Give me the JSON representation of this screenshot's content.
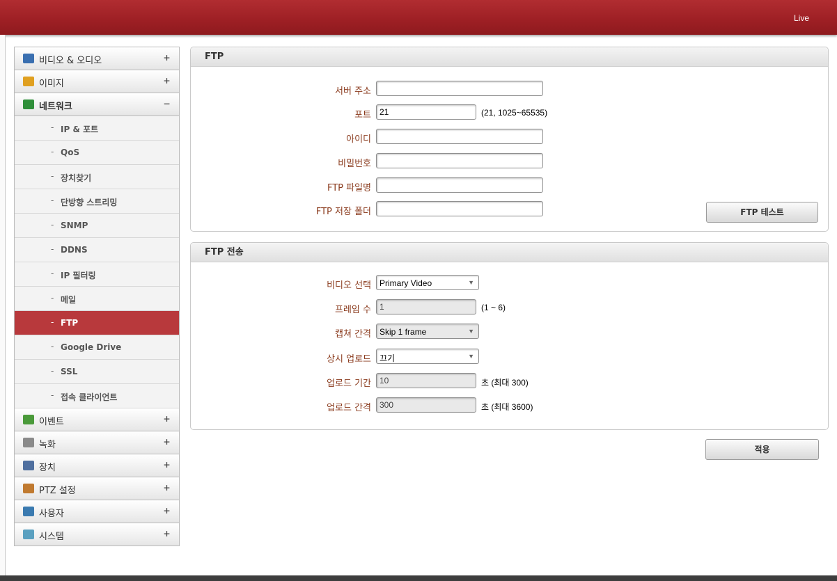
{
  "header": {
    "live_label": "Live"
  },
  "sidebar": {
    "menus_top": [
      {
        "label": "비디오 & 오디오",
        "toggle": "+",
        "icon": "video-audio-icon",
        "color": "#3a6fb0"
      },
      {
        "label": "이미지",
        "toggle": "+",
        "icon": "image-icon",
        "color": "#e0a020"
      },
      {
        "label": "네트워크",
        "toggle": "−",
        "icon": "network-icon",
        "color": "#2f8f3a"
      }
    ],
    "sub_items": [
      {
        "label": "IP & 포트"
      },
      {
        "label": "QoS"
      },
      {
        "label": "장치찾기"
      },
      {
        "label": "단방향 스트리밍"
      },
      {
        "label": "SNMP"
      },
      {
        "label": "DDNS"
      },
      {
        "label": "IP 필터링"
      },
      {
        "label": "메일"
      },
      {
        "label": "FTP"
      },
      {
        "label": "Google Drive"
      },
      {
        "label": "SSL"
      },
      {
        "label": "접속 클라이언트"
      }
    ],
    "sub_bullet": "-",
    "menus_bottom": [
      {
        "label": "이벤트",
        "toggle": "+",
        "icon": "event-icon",
        "color": "#4a9a3a"
      },
      {
        "label": "녹화",
        "toggle": "+",
        "icon": "record-icon",
        "color": "#8a8a8a"
      },
      {
        "label": "장치",
        "toggle": "+",
        "icon": "device-icon",
        "color": "#4f6f9f"
      },
      {
        "label": "PTZ 설정",
        "toggle": "+",
        "icon": "ptz-icon",
        "color": "#c07a30"
      },
      {
        "label": "사용자",
        "toggle": "+",
        "icon": "user-icon",
        "color": "#3a7ab0"
      },
      {
        "label": "시스템",
        "toggle": "+",
        "icon": "system-icon",
        "color": "#5aa0c0"
      }
    ],
    "active_color": "#b8393c"
  },
  "ftp_panel": {
    "title": "FTP",
    "server_label": "서버 주소",
    "server_value": "",
    "port_label": "포트",
    "port_value": "21",
    "port_hint": "(21, 1025~65535)",
    "id_label": "아이디",
    "id_value": "",
    "password_label": "비밀번호",
    "password_value": "",
    "filename_label": "FTP 파일명",
    "filename_value": "",
    "folder_label": "FTP 저장 폴더",
    "folder_value": "",
    "test_button": "FTP 테스트"
  },
  "transfer_panel": {
    "title": "FTP 전송",
    "video_label": "비디오 선택",
    "video_value": "Primary Video",
    "frames_label": "프레임 수",
    "frames_value": "1",
    "frames_hint": "(1 ~ 6)",
    "capture_label": "캡쳐 간격",
    "capture_value": "Skip 1 frame",
    "always_label": "상시 업로드",
    "always_value": "끄기",
    "duration_label": "업로드 기간",
    "duration_value": "10",
    "duration_hint": "초 (최대 300)",
    "interval_label": "업로드 간격",
    "interval_value": "300",
    "interval_hint": "초 (최대 3600)"
  },
  "apply_button": "적용"
}
